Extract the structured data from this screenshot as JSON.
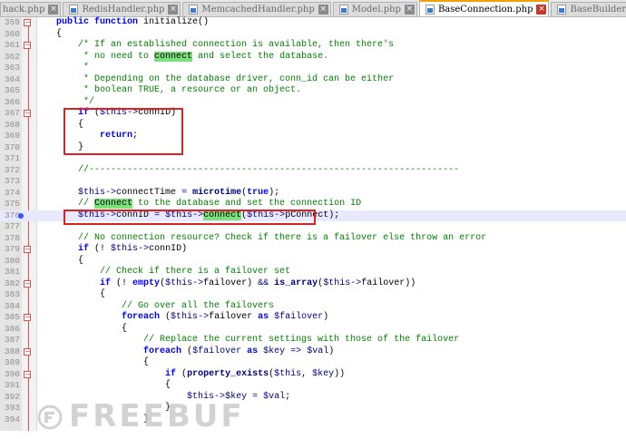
{
  "tabs": [
    {
      "label": "hack.php",
      "active": false
    },
    {
      "label": "RedisHandler.php",
      "active": false
    },
    {
      "label": "MemcachedHandler.php",
      "active": false
    },
    {
      "label": "Model.php",
      "active": false
    },
    {
      "label": "BaseConnection.php",
      "active": true
    },
    {
      "label": "BaseBuilder.php",
      "active": false
    }
  ],
  "current_line": 376,
  "highlight_word": "connect",
  "lines": [
    {
      "n": 359,
      "fold": "box",
      "tokens": [
        [
          "t",
          "    "
        ],
        [
          "kw",
          "public function"
        ],
        [
          "t",
          " initialize()"
        ]
      ]
    },
    {
      "n": 360,
      "tokens": [
        [
          "t",
          "    {"
        ]
      ]
    },
    {
      "n": 361,
      "fold": "box",
      "tokens": [
        [
          "cm",
          "        /* If an established connection is available, then there's"
        ]
      ]
    },
    {
      "n": 362,
      "tokens": [
        [
          "cm",
          "         * no need to "
        ],
        [
          "hl",
          "connect"
        ],
        [
          "cm",
          " and select the database."
        ]
      ]
    },
    {
      "n": 363,
      "tokens": [
        [
          "cm",
          "         *"
        ]
      ]
    },
    {
      "n": 364,
      "tokens": [
        [
          "cm",
          "         * Depending on the database driver, conn_id can be either"
        ]
      ]
    },
    {
      "n": 365,
      "tokens": [
        [
          "cm",
          "         * boolean TRUE, a resource or an object."
        ]
      ]
    },
    {
      "n": 366,
      "tokens": [
        [
          "cm",
          "         */"
        ]
      ]
    },
    {
      "n": 367,
      "fold": "box",
      "tokens": [
        [
          "t",
          "        "
        ],
        [
          "kw",
          "if"
        ],
        [
          "t",
          " ("
        ],
        [
          "var",
          "$this"
        ],
        [
          "op",
          "->"
        ],
        [
          "t",
          "connID)"
        ]
      ]
    },
    {
      "n": 368,
      "tokens": [
        [
          "t",
          "        {"
        ]
      ]
    },
    {
      "n": 369,
      "tokens": [
        [
          "t",
          "            "
        ],
        [
          "kw",
          "return"
        ],
        [
          "t",
          ";"
        ]
      ]
    },
    {
      "n": 370,
      "tokens": [
        [
          "t",
          "        }"
        ]
      ]
    },
    {
      "n": 371,
      "tokens": []
    },
    {
      "n": 372,
      "tokens": [
        [
          "cm",
          "        //--------------------------------------------------------------------"
        ]
      ]
    },
    {
      "n": 373,
      "tokens": []
    },
    {
      "n": 374,
      "tokens": [
        [
          "t",
          "        "
        ],
        [
          "var",
          "$this"
        ],
        [
          "op",
          "->"
        ],
        [
          "t",
          "connectTime "
        ],
        [
          "op",
          "="
        ],
        [
          "t",
          " "
        ],
        [
          "fn",
          "microtime"
        ],
        [
          "t",
          "("
        ],
        [
          "kw",
          "true"
        ],
        [
          "t",
          ");"
        ]
      ]
    },
    {
      "n": 375,
      "tokens": [
        [
          "cm",
          "        // "
        ],
        [
          "hl",
          "Connect"
        ],
        [
          "cm",
          " to the database and set the connection ID"
        ]
      ]
    },
    {
      "n": 376,
      "bp": true,
      "tokens": [
        [
          "t",
          "        "
        ],
        [
          "var",
          "$this"
        ],
        [
          "op",
          "->"
        ],
        [
          "t",
          "connID "
        ],
        [
          "op",
          "="
        ],
        [
          "t",
          " "
        ],
        [
          "var",
          "$this"
        ],
        [
          "op",
          "->"
        ],
        [
          "hl",
          "connect"
        ],
        [
          "t",
          "("
        ],
        [
          "var",
          "$this"
        ],
        [
          "op",
          "->"
        ],
        [
          "t",
          "pConnect);"
        ]
      ]
    },
    {
      "n": 377,
      "tokens": []
    },
    {
      "n": 378,
      "tokens": [
        [
          "cm",
          "        // No connection resource? Check if there is a failover else throw an error"
        ]
      ]
    },
    {
      "n": 379,
      "fold": "box",
      "tokens": [
        [
          "t",
          "        "
        ],
        [
          "kw",
          "if"
        ],
        [
          "t",
          " (! "
        ],
        [
          "var",
          "$this"
        ],
        [
          "op",
          "->"
        ],
        [
          "t",
          "connID)"
        ]
      ]
    },
    {
      "n": 380,
      "tokens": [
        [
          "t",
          "        {"
        ]
      ]
    },
    {
      "n": 381,
      "tokens": [
        [
          "cm",
          "            // Check if there is a failover set"
        ]
      ]
    },
    {
      "n": 382,
      "fold": "box",
      "tokens": [
        [
          "t",
          "            "
        ],
        [
          "kw",
          "if"
        ],
        [
          "t",
          " (! "
        ],
        [
          "kw",
          "empty"
        ],
        [
          "t",
          "("
        ],
        [
          "var",
          "$this"
        ],
        [
          "op",
          "->"
        ],
        [
          "t",
          "failover) "
        ],
        [
          "op",
          "&&"
        ],
        [
          "t",
          " "
        ],
        [
          "fn",
          "is_array"
        ],
        [
          "t",
          "("
        ],
        [
          "var",
          "$this"
        ],
        [
          "op",
          "->"
        ],
        [
          "t",
          "failover))"
        ]
      ]
    },
    {
      "n": 383,
      "tokens": [
        [
          "t",
          "            {"
        ]
      ]
    },
    {
      "n": 384,
      "tokens": [
        [
          "cm",
          "                // Go over all the failovers"
        ]
      ]
    },
    {
      "n": 385,
      "fold": "box",
      "tokens": [
        [
          "t",
          "                "
        ],
        [
          "kw",
          "foreach"
        ],
        [
          "t",
          " ("
        ],
        [
          "var",
          "$this"
        ],
        [
          "op",
          "->"
        ],
        [
          "t",
          "failover "
        ],
        [
          "kw",
          "as"
        ],
        [
          "t",
          " "
        ],
        [
          "var",
          "$failover"
        ],
        [
          "t",
          ")"
        ]
      ]
    },
    {
      "n": 386,
      "tokens": [
        [
          "t",
          "                {"
        ]
      ]
    },
    {
      "n": 387,
      "tokens": [
        [
          "cm",
          "                    // Replace the current settings with those of the failover"
        ]
      ]
    },
    {
      "n": 388,
      "fold": "box",
      "tokens": [
        [
          "t",
          "                    "
        ],
        [
          "kw",
          "foreach"
        ],
        [
          "t",
          " ("
        ],
        [
          "var",
          "$failover"
        ],
        [
          "t",
          " "
        ],
        [
          "kw",
          "as"
        ],
        [
          "t",
          " "
        ],
        [
          "var",
          "$key"
        ],
        [
          "t",
          " "
        ],
        [
          "op",
          "=>"
        ],
        [
          "t",
          " "
        ],
        [
          "var",
          "$val"
        ],
        [
          "t",
          ")"
        ]
      ]
    },
    {
      "n": 389,
      "tokens": [
        [
          "t",
          "                    {"
        ]
      ]
    },
    {
      "n": 390,
      "fold": "box",
      "tokens": [
        [
          "t",
          "                        "
        ],
        [
          "kw",
          "if"
        ],
        [
          "t",
          " ("
        ],
        [
          "fn",
          "property_exists"
        ],
        [
          "t",
          "("
        ],
        [
          "var",
          "$this"
        ],
        [
          "t",
          ", "
        ],
        [
          "var",
          "$key"
        ],
        [
          "t",
          "))"
        ]
      ]
    },
    {
      "n": 391,
      "tokens": [
        [
          "t",
          "                        {"
        ]
      ]
    },
    {
      "n": 392,
      "tokens": [
        [
          "t",
          "                            "
        ],
        [
          "var",
          "$this"
        ],
        [
          "op",
          "->"
        ],
        [
          "var",
          "$key"
        ],
        [
          "t",
          " "
        ],
        [
          "op",
          "="
        ],
        [
          "t",
          " "
        ],
        [
          "var",
          "$val"
        ],
        [
          "t",
          ";"
        ]
      ]
    },
    {
      "n": 393,
      "tokens": [
        [
          "t",
          "                        }"
        ]
      ]
    },
    {
      "n": 394,
      "tokens": [
        [
          "t",
          "                    }"
        ]
      ]
    }
  ],
  "watermark": {
    "text": "FREEBUF"
  },
  "colors": {
    "keyword": "#0000ff",
    "comment": "#008000",
    "variable": "#000080",
    "find_highlight": "#7ce07c",
    "annotation_box": "#e02020",
    "tab_active_accent": "#f0a000"
  }
}
